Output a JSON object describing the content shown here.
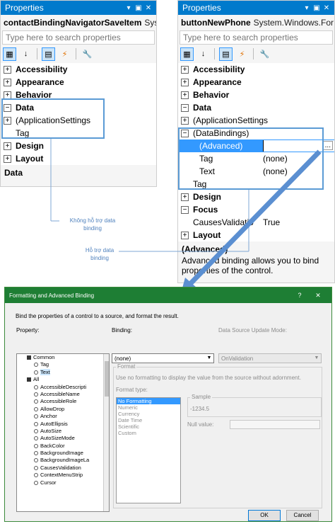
{
  "left_panel": {
    "title": "Properties",
    "object_name": "contactBindingNavigatorSaveItem",
    "object_type": "Sys",
    "search_placeholder": "Type here to search properties",
    "rows": [
      {
        "label": "Accessibility",
        "kind": "cat",
        "expander": "+"
      },
      {
        "label": "Appearance",
        "kind": "cat",
        "expander": "+"
      },
      {
        "label": "Behavior",
        "kind": "cat",
        "expander": "+"
      },
      {
        "label": "Data",
        "kind": "cat",
        "expander": "−"
      },
      {
        "label": "(ApplicationSettings",
        "kind": "prop",
        "expander": "+"
      },
      {
        "label": "Tag",
        "kind": "prop",
        "expander": ""
      },
      {
        "label": "Design",
        "kind": "cat",
        "expander": "+"
      },
      {
        "label": "Layout",
        "kind": "cat",
        "expander": "+"
      }
    ],
    "description_title": "Data",
    "description_text": ""
  },
  "right_panel": {
    "title": "Properties",
    "object_name": "buttonNewPhone",
    "object_type": "System.Windows.For",
    "search_placeholder": "Type here to search properties",
    "rows": [
      {
        "label": "Accessibility",
        "kind": "cat",
        "expander": "+",
        "value": ""
      },
      {
        "label": "Appearance",
        "kind": "cat",
        "expander": "+",
        "value": ""
      },
      {
        "label": "Behavior",
        "kind": "cat",
        "expander": "+",
        "value": ""
      },
      {
        "label": "Data",
        "kind": "cat",
        "expander": "−",
        "value": ""
      },
      {
        "label": "(ApplicationSettings",
        "kind": "prop",
        "expander": "+",
        "value": ""
      },
      {
        "label": "(DataBindings)",
        "kind": "prop",
        "expander": "−",
        "value": ""
      },
      {
        "label": "(Advanced)",
        "kind": "sub",
        "expander": "",
        "value": "",
        "selected": true
      },
      {
        "label": "Tag",
        "kind": "sub",
        "expander": "",
        "value": "(none)"
      },
      {
        "label": "Text",
        "kind": "sub",
        "expander": "",
        "value": "(none)"
      },
      {
        "label": "Tag",
        "kind": "prop",
        "expander": "",
        "value": ""
      },
      {
        "label": "Design",
        "kind": "cat",
        "expander": "+",
        "value": ""
      },
      {
        "label": "Focus",
        "kind": "cat",
        "expander": "−",
        "value": ""
      },
      {
        "label": "CausesValidatio",
        "kind": "prop",
        "expander": "",
        "value": "True"
      },
      {
        "label": "Layout",
        "kind": "cat",
        "expander": "+",
        "value": ""
      }
    ],
    "ellipsis": "...",
    "description_title": "(Advanced)",
    "description_text": "Advanced binding allows you to bind properties of the control."
  },
  "annotations": {
    "not_supported": "Không hỗ trợ data binding",
    "supported": "Hỗ trợ data binding"
  },
  "dialog": {
    "title": "Formatting and Advanced Binding",
    "help_button": "?",
    "close_button": "✕",
    "instruction": "Bind the properties of a control to a source, and format the result.",
    "property_label": "Property:",
    "binding_label": "Binding:",
    "binding_value": "(none)",
    "update_mode_label": "Data Source Update Mode:",
    "update_mode_value": "OnValidation",
    "format_group_label": "Format",
    "format_hint": "Use no formatting to display the value from the source without adornment.",
    "format_type_label": "Format type:",
    "format_types": [
      "No Formatting",
      "Numeric",
      "Currency",
      "Date Time",
      "Scientific",
      "Custom"
    ],
    "sample_label": "Sample",
    "sample_value": "-1234.5",
    "null_value_label": "Null value:",
    "tree": [
      {
        "label": "Common",
        "level": 0,
        "group": true
      },
      {
        "label": "Tag",
        "level": 1
      },
      {
        "label": "Text",
        "level": 1,
        "selected": true
      },
      {
        "label": "All",
        "level": 0,
        "group": true
      },
      {
        "label": "AccessibleDescripti",
        "level": 1
      },
      {
        "label": "AccessibleName",
        "level": 1
      },
      {
        "label": "AccessibleRole",
        "level": 1
      },
      {
        "label": "AllowDrop",
        "level": 1
      },
      {
        "label": "Anchor",
        "level": 1
      },
      {
        "label": "AutoEllipsis",
        "level": 1
      },
      {
        "label": "AutoSize",
        "level": 1
      },
      {
        "label": "AutoSizeMode",
        "level": 1
      },
      {
        "label": "BackColor",
        "level": 1
      },
      {
        "label": "BackgroundImage",
        "level": 1
      },
      {
        "label": "BackgroundImageLa",
        "level": 1
      },
      {
        "label": "CausesValidation",
        "level": 1
      },
      {
        "label": "ContextMenuStrip",
        "level": 1
      },
      {
        "label": "Cursor",
        "level": 1
      }
    ],
    "ok_label": "OK",
    "cancel_label": "Cancel"
  },
  "colors": {
    "titlebar_blue": "#007acc",
    "dialog_green": "#1e7e34",
    "highlight_border": "#5b9bd5",
    "selection": "#3399ff"
  }
}
